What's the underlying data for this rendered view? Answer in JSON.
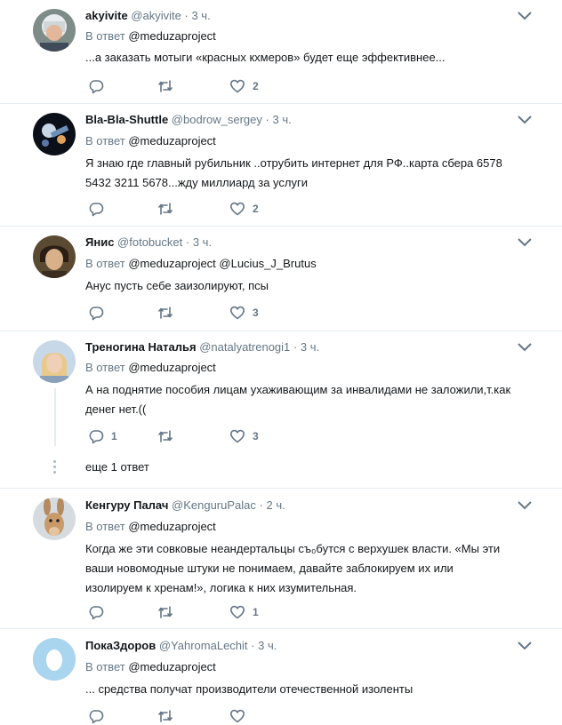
{
  "labels": {
    "reply_prefix": "В ответ"
  },
  "tweets": [
    {
      "name": "akyivite",
      "handle": "@akyivite",
      "time": "3 ч.",
      "mention": "@meduzaproject",
      "text": "...а заказать мотыги «красных кхмеров» будет еще эффективнее...",
      "replies": "",
      "retweets": "",
      "likes": "2"
    },
    {
      "name": "Bla-Bla-Shuttle",
      "handle": "@bodrow_sergey",
      "time": "3 ч.",
      "mention": "@meduzaproject",
      "text": "Я знаю где главный рубильник ..отрубить интернет для РФ..карта сбера 6578 5432 3211 5678...жду миллиард за услуги",
      "replies": "",
      "retweets": "",
      "likes": "2"
    },
    {
      "name": "Янис",
      "handle": "@fotobucket",
      "time": "3 ч.",
      "mention": "@meduzaproject @Lucius_J_Brutus",
      "text": "Анус пусть себе заизолируют, псы",
      "replies": "",
      "retweets": "",
      "likes": "3"
    },
    {
      "name": "Треногина Наталья",
      "handle": "@natalyatrenogi1",
      "time": "3 ч.",
      "mention": "@meduzaproject",
      "text": "А на поднятие пособия лицам ухаживающим за инвалидами не заложили,т.как денег нет.((",
      "replies": "1",
      "retweets": "",
      "likes": "3",
      "more": "еще 1 ответ"
    },
    {
      "name": "Кенгуру Палач",
      "handle": "@KenguruPalac",
      "time": "2 ч.",
      "mention": "@meduzaproject",
      "text": "Когда же эти совковые неандертальцы съ₀бутся с верхушек власти. «Мы эти ваши новомодные штуки не понимаем, давайте заблокируем их или изолируем к хренам!», логика к них изумительная.",
      "replies": "",
      "retweets": "",
      "likes": "1"
    },
    {
      "name": "ПокаЗдоров",
      "handle": "@YahromaLechit",
      "time": "3 ч.",
      "mention": "@meduzaproject",
      "text": "... средства получат производители отечественной изоленты",
      "replies": "",
      "retweets": "",
      "likes": ""
    }
  ],
  "colors": {
    "text": "#14171a",
    "muted": "#657786",
    "divider": "#e6ecf0",
    "accent": "#1da1f2"
  },
  "icons": [
    "reply-icon",
    "retweet-icon",
    "heart-icon",
    "chevron-down-icon"
  ]
}
